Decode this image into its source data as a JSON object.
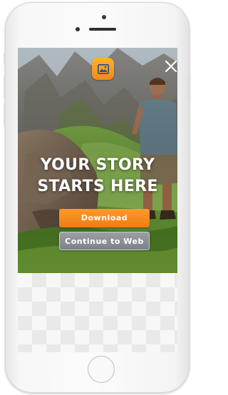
{
  "ad": {
    "headline_line1": "YOUR STORY",
    "headline_line2": "STARTS HERE",
    "download_label": "Download",
    "continue_label": "Continue to Web"
  },
  "icons": {
    "app": "image-icon",
    "close": "close-icon"
  },
  "colors": {
    "download_button": "#f5861a",
    "continue_button": "#8c9096",
    "app_icon": "#f89a24"
  }
}
